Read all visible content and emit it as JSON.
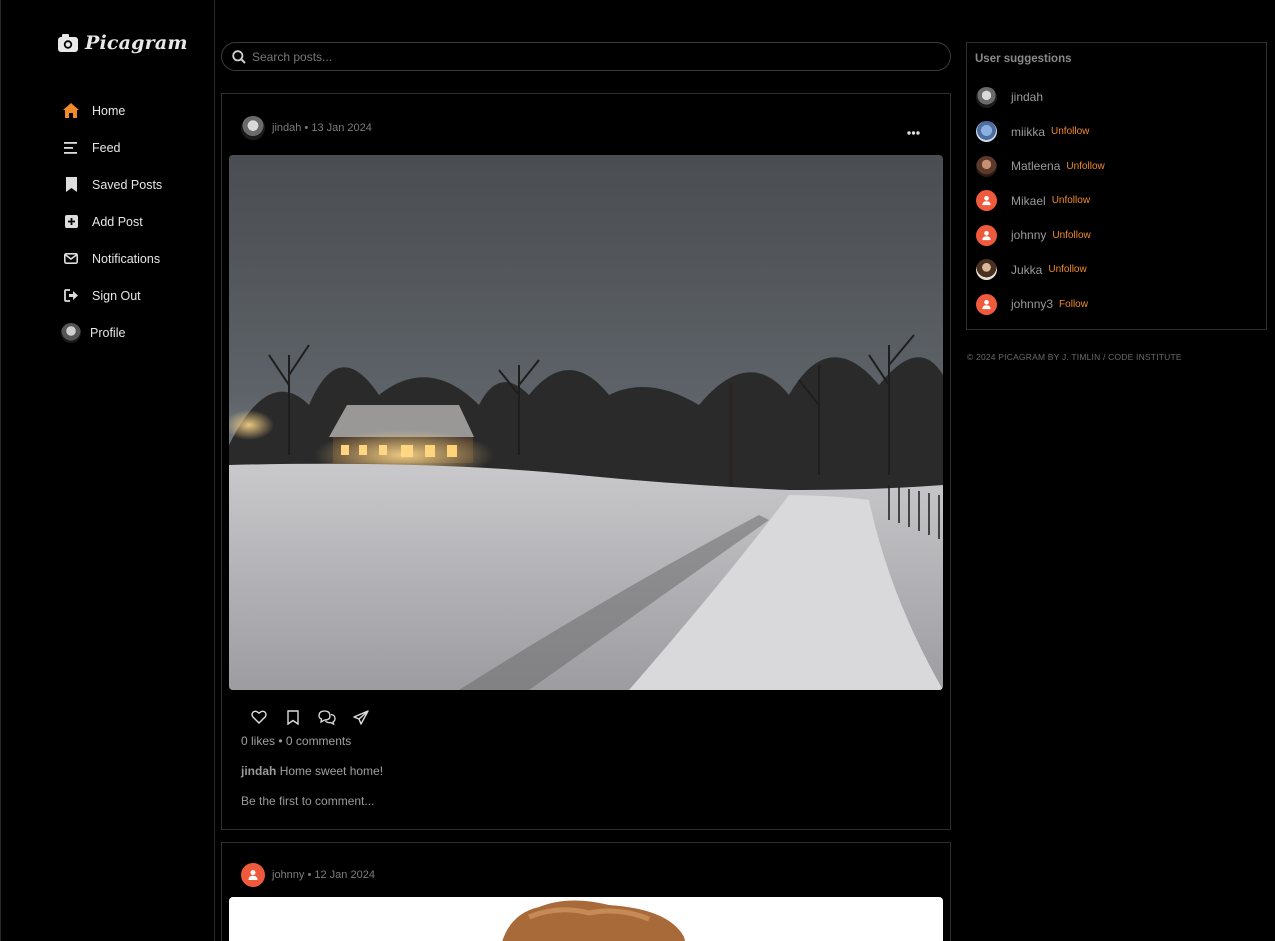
{
  "app": {
    "name": "Picagram"
  },
  "nav": {
    "items": [
      {
        "label": "Home",
        "icon": "home-icon",
        "active": true
      },
      {
        "label": "Feed",
        "icon": "feed-icon"
      },
      {
        "label": "Saved Posts",
        "icon": "bookmark-icon"
      },
      {
        "label": "Add Post",
        "icon": "add-icon"
      },
      {
        "label": "Notifications",
        "icon": "envelope-icon"
      },
      {
        "label": "Sign Out",
        "icon": "signout-icon"
      },
      {
        "label": "Profile",
        "icon": "avatar"
      }
    ]
  },
  "search": {
    "placeholder": "Search posts..."
  },
  "posts": [
    {
      "author": "jindah",
      "meta": "jindah • 13 Jan 2024",
      "likes_comments": "0 likes • 0 comments",
      "caption_author": "jindah",
      "caption_text": "Home sweet home!",
      "first_comment": "Be the first to comment..."
    },
    {
      "author": "johnny",
      "meta": "johnny • 12 Jan 2024"
    }
  ],
  "suggestions": {
    "title": "User suggestions",
    "users": [
      {
        "name": "jindah",
        "action": ""
      },
      {
        "name": "miikka",
        "action": "Unfollow"
      },
      {
        "name": "Matleena",
        "action": "Unfollow"
      },
      {
        "name": "Mikael",
        "action": "Unfollow"
      },
      {
        "name": "johnny",
        "action": "Unfollow"
      },
      {
        "name": "Jukka",
        "action": "Unfollow"
      },
      {
        "name": "johnny3",
        "action": "Follow"
      }
    ]
  },
  "footer": "© 2024 PICAGRAM BY J. TIMLIN / CODE INSTITUTE",
  "colors": {
    "accent": "#f08a2a",
    "background": "#000000",
    "avatar_default": "#f05a3c"
  }
}
